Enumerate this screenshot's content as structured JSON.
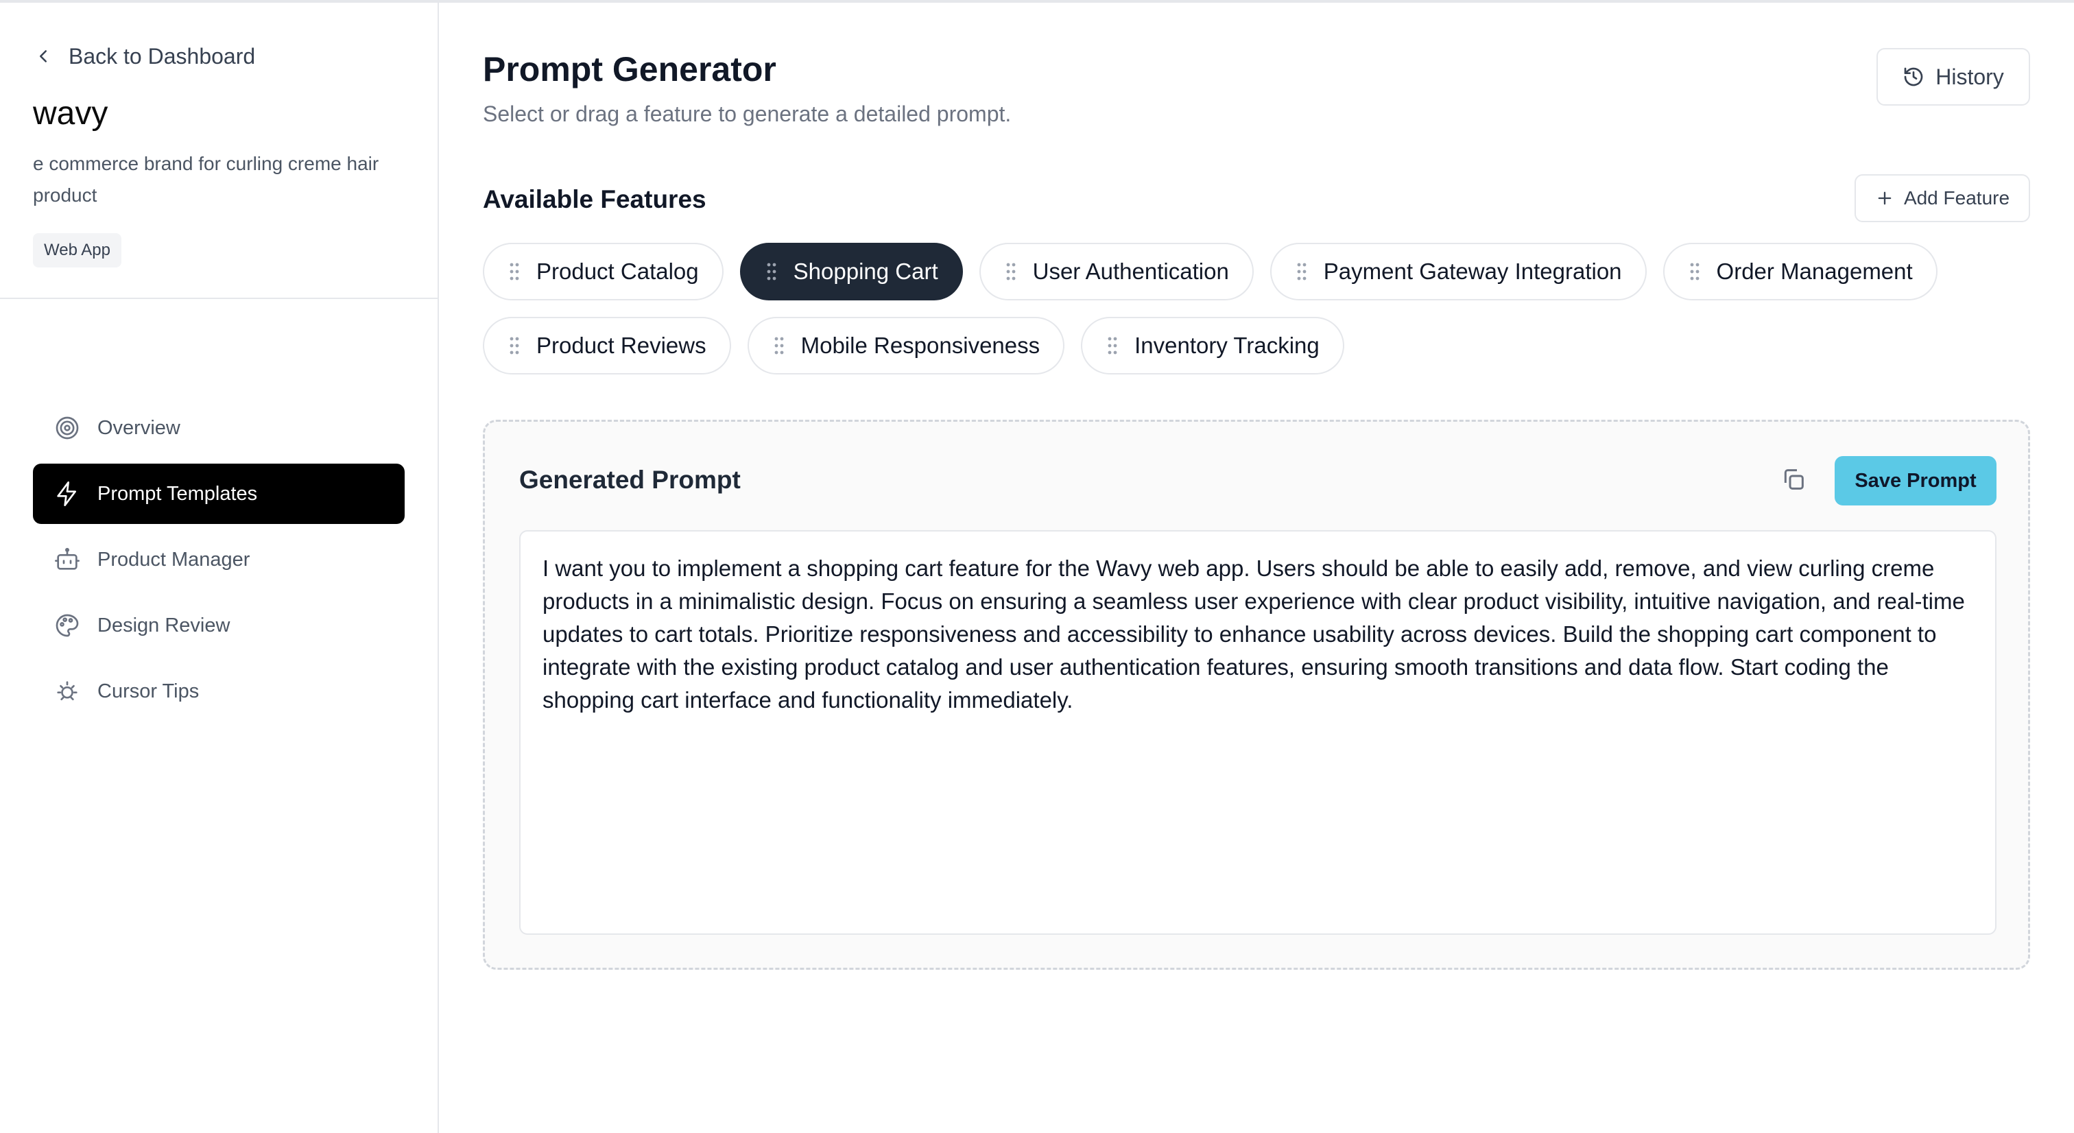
{
  "sidebar": {
    "back_label": "Back to Dashboard",
    "project_name": "wavy",
    "project_description": "e commerce brand for curling creme hair product",
    "project_badge": "Web App",
    "nav_items": [
      {
        "label": "Overview",
        "icon": "target-icon",
        "active": false
      },
      {
        "label": "Prompt Templates",
        "icon": "lightning-icon",
        "active": true
      },
      {
        "label": "Product Manager",
        "icon": "bot-icon",
        "active": false
      },
      {
        "label": "Design Review",
        "icon": "palette-icon",
        "active": false
      },
      {
        "label": "Cursor Tips",
        "icon": "sun-bug-icon",
        "active": false
      }
    ]
  },
  "main": {
    "title": "Prompt Generator",
    "subtitle": "Select or drag a feature to generate a detailed prompt.",
    "history_label": "History",
    "features_title": "Available Features",
    "add_feature_label": "Add Feature",
    "features": [
      {
        "label": "Product Catalog",
        "selected": false
      },
      {
        "label": "Shopping Cart",
        "selected": true
      },
      {
        "label": "User Authentication",
        "selected": false
      },
      {
        "label": "Payment Gateway Integration",
        "selected": false
      },
      {
        "label": "Order Management",
        "selected": false
      },
      {
        "label": "Product Reviews",
        "selected": false
      },
      {
        "label": "Mobile Responsiveness",
        "selected": false
      },
      {
        "label": "Inventory Tracking",
        "selected": false
      }
    ],
    "generated_prompt": {
      "title": "Generated Prompt",
      "save_label": "Save Prompt",
      "text": "I want you to implement a shopping cart feature for the Wavy web app. Users should be able to easily add, remove, and view curling creme products in a minimalistic design. Focus on ensuring a seamless user experience with clear product visibility, intuitive navigation, and real-time updates to cart totals. Prioritize responsiveness and accessibility to enhance usability across devices. Build the shopping cart component to integrate with the existing product catalog and user authentication features, ensuring smooth transitions and data flow. Start coding the shopping cart interface and functionality immediately."
    }
  },
  "colors": {
    "accent": "#5bc9e6",
    "selected_chip": "#1f2937",
    "active_nav": "#000000"
  }
}
